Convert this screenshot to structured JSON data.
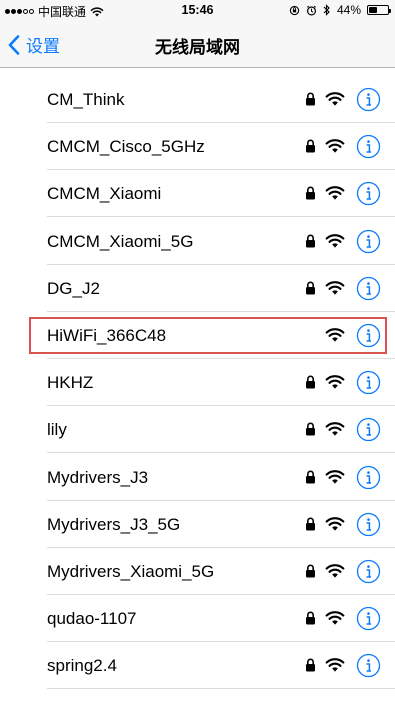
{
  "status_bar": {
    "carrier": "中国联通",
    "time": "15:46",
    "battery": "44%",
    "battery_level": 0.44,
    "signal_bars": 3,
    "icons": [
      "wifi-icon",
      "orientation-lock-icon",
      "alarm-icon",
      "bluetooth-icon",
      "battery-icon"
    ]
  },
  "nav": {
    "back_label": "设置",
    "title": "无线局域网"
  },
  "networks": [
    {
      "name": "CM_Think",
      "secured": true
    },
    {
      "name": "CMCM_Cisco_5GHz",
      "secured": true
    },
    {
      "name": "CMCM_Xiaomi",
      "secured": true
    },
    {
      "name": "CMCM_Xiaomi_5G",
      "secured": true
    },
    {
      "name": "DG_J2",
      "secured": true
    },
    {
      "name": "HiWiFi_366C48",
      "secured": false,
      "highlighted": true
    },
    {
      "name": "HKHZ",
      "secured": true
    },
    {
      "name": "lily",
      "secured": true
    },
    {
      "name": "Mydrivers_J3",
      "secured": true
    },
    {
      "name": "Mydrivers_J3_5G",
      "secured": true
    },
    {
      "name": "Mydrivers_Xiaomi_5G",
      "secured": true
    },
    {
      "name": "qudao-1107",
      "secured": true
    },
    {
      "name": "spring2.4",
      "secured": true
    }
  ],
  "colors": {
    "accent": "#0a7aff",
    "highlight": "#d9534f"
  }
}
